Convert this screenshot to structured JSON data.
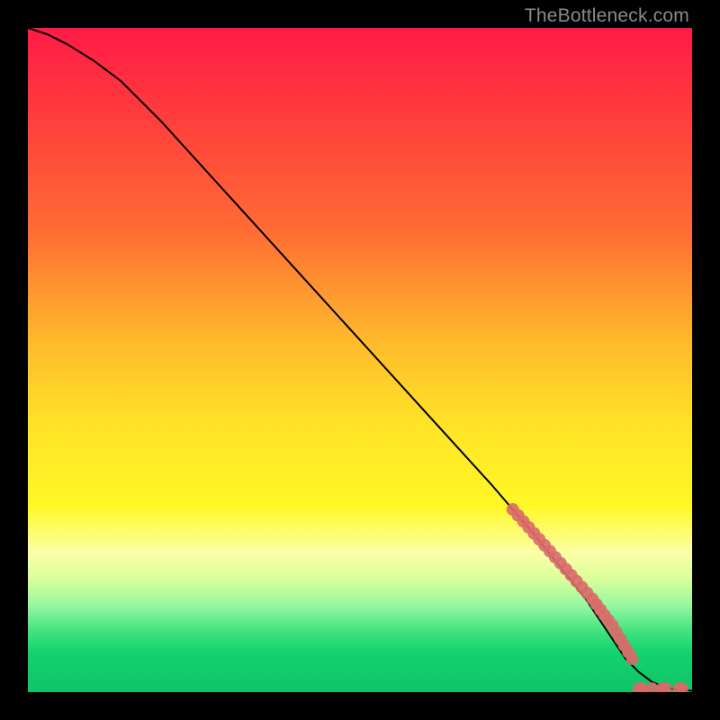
{
  "attribution": "TheBottleneck.com",
  "chart_data": {
    "type": "line",
    "title": "",
    "xlabel": "",
    "ylabel": "",
    "xlim": [
      0,
      100
    ],
    "ylim": [
      0,
      100
    ],
    "grid": false,
    "series": [
      {
        "name": "curve",
        "style": "line",
        "color": "#000000",
        "x": [
          0,
          3,
          6,
          10,
          14,
          20,
          30,
          40,
          50,
          60,
          70,
          76,
          80,
          84,
          88,
          90,
          92,
          94,
          96,
          98,
          100
        ],
        "y": [
          100,
          99,
          97.5,
          95,
          92,
          86,
          75,
          64,
          53,
          42,
          31,
          24,
          19,
          14,
          8,
          5,
          3,
          1.5,
          0.7,
          0.3,
          0.2
        ]
      },
      {
        "name": "dots",
        "style": "scatter",
        "color": "#d96a6a",
        "x": [
          73,
          73.8,
          74.6,
          75.4,
          76.2,
          77,
          77.8,
          78.6,
          79.4,
          80.2,
          81,
          81.8,
          82.6,
          83.4,
          84.2,
          85,
          85.6,
          86.2,
          86.8,
          87.4,
          88,
          88.6,
          89.2,
          89.8,
          90.4,
          91,
          92,
          92.5,
          94,
          95.5,
          96,
          98,
          98.5
        ],
        "y": [
          27.5,
          26.6,
          25.7,
          24.8,
          23.9,
          23,
          22.1,
          21.2,
          20.3,
          19.4,
          18.5,
          17.6,
          16.7,
          15.8,
          14.9,
          14,
          13.2,
          12.4,
          11.6,
          10.8,
          10,
          9,
          8,
          7,
          6,
          5,
          0.5,
          0.5,
          0.5,
          0.5,
          0.5,
          0.5,
          0.5
        ]
      }
    ]
  }
}
